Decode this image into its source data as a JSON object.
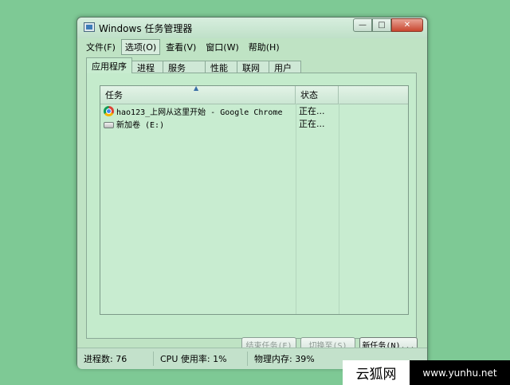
{
  "window": {
    "title": "Windows 任务管理器",
    "minimize": "—",
    "maximize": "□",
    "close": "✕"
  },
  "menu": [
    "文件(F)",
    "选项(O)",
    "查看(V)",
    "窗口(W)",
    "帮助(H)"
  ],
  "tabs": [
    "应用程序",
    "进程",
    "服务",
    "性能",
    "联网",
    "用户"
  ],
  "columns": {
    "task": "任务",
    "status": "状态",
    "sort_indicator": "▲"
  },
  "rows": [
    {
      "icon": "chrome-icon",
      "name": "hao123_上网从这里开始 - Google Chrome",
      "status": "正在..."
    },
    {
      "icon": "drive-icon",
      "name": "新加卷 (E:)",
      "status": "正在..."
    }
  ],
  "buttons": {
    "end_task": "结束任务(E)",
    "switch_to": "切换至(S)",
    "new_task": "新任务(N)..."
  },
  "statusbar": {
    "processes": "进程数: 76",
    "cpu": "CPU 使用率: 1%",
    "memory": "物理内存: 39%"
  },
  "watermark": {
    "left": "云狐网",
    "right": "www.yunhu.net"
  },
  "colors": {
    "desktop": "#7ec995",
    "window": "#bfe3c4"
  }
}
